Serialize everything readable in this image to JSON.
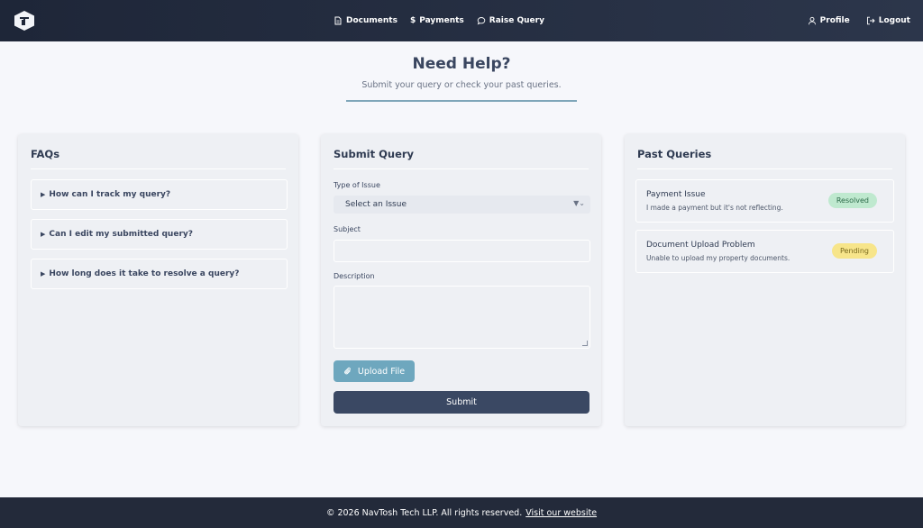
{
  "nav": {
    "logo_icon": "logo-icon",
    "links": [
      {
        "label": "Documents",
        "icon": "document-icon"
      },
      {
        "label": "Payments",
        "icon": "dollar-icon"
      },
      {
        "label": "Raise Query",
        "icon": "chat-bubble-icon"
      }
    ],
    "profile_label": "Profile",
    "logout_label": "Logout"
  },
  "hero": {
    "title": "Need Help?",
    "subtitle": "Submit your query or check your past queries."
  },
  "faqs": {
    "title": "FAQs",
    "items": [
      "How can I track my query?",
      "Can I edit my submitted query?",
      "How long does it take to resolve a query?"
    ]
  },
  "submit_query": {
    "title": "Submit Query",
    "type_label": "Type of Issue",
    "type_value": "Select an Issue",
    "subject_label": "Subject",
    "subject_value": "",
    "description_label": "Description",
    "description_value": "",
    "upload_label": "Upload File",
    "submit_label": "Submit"
  },
  "past_queries": {
    "title": "Past Queries",
    "items": [
      {
        "title": "Payment Issue",
        "description": "I made a payment but it's not reflecting.",
        "status": "Resolved"
      },
      {
        "title": "Document Upload Problem",
        "description": "Unable to upload my property documents.",
        "status": "Pending"
      }
    ]
  },
  "footer": {
    "text": "© 2026 NavTosh Tech LLP. All rights reserved.",
    "link": "Visit our website"
  },
  "colors": {
    "navbar": "#1e2638",
    "accent": "#6ea7be",
    "submit": "#3a4863",
    "resolved": "#bfe9cf",
    "pending": "#f7e58a"
  }
}
